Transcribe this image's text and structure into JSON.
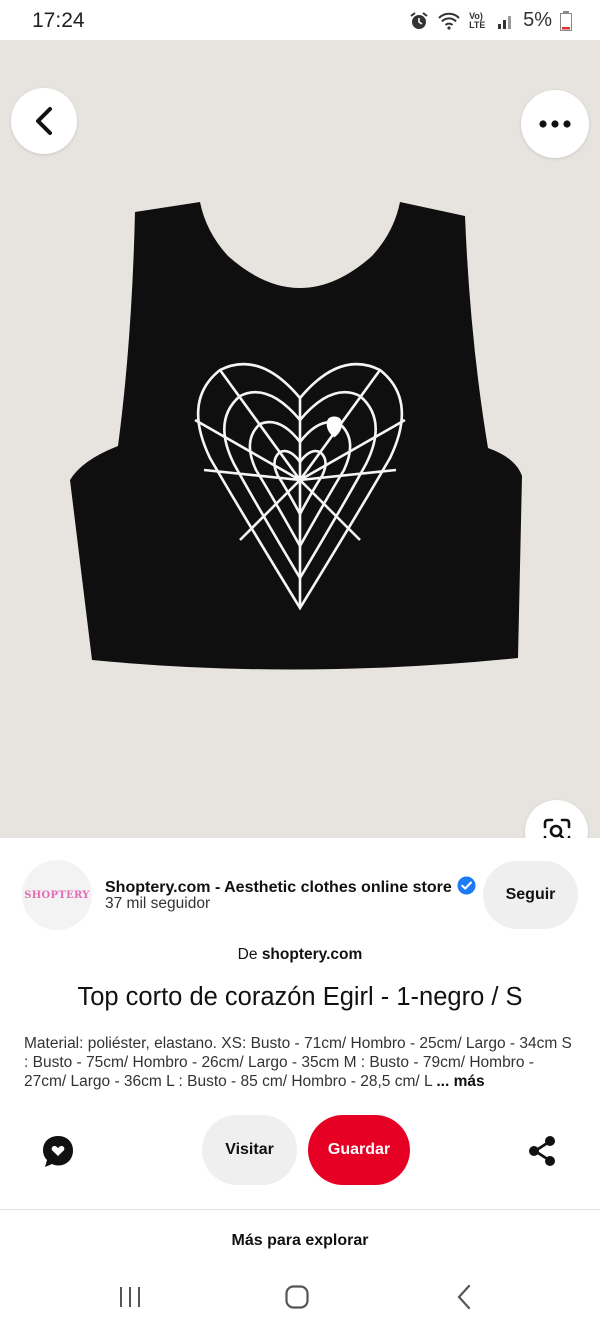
{
  "status_bar": {
    "time": "17:24",
    "network_label": "Vo) LTE",
    "battery": "5%"
  },
  "hero": {
    "icons": {
      "back": "chevron-left-icon",
      "more": "more-horizontal-icon",
      "lens": "visual-search-icon"
    }
  },
  "store": {
    "avatar_text": "SHOPTERY",
    "name": "Shoptery.com - Aesthetic clothes online store",
    "followers": "37 mil seguidor",
    "follow_label": "Seguir",
    "verified_color": "#1d7bf5"
  },
  "source": {
    "prefix": "De",
    "domain": "shoptery.com"
  },
  "pin": {
    "title": "Top corto de corazón Egirl - 1-negro / S",
    "description": "Material: poliéster, elastano. XS: Busto - 71cm/ Hombro - 25cm/ Largo - 34cm S : Busto - 75cm/ Hombro - 26cm/ Largo - 35cm M : Busto - 79cm/ Hombro - 27cm/ Largo - 36cm L : Busto - 85 cm/ Hombro - 28,5 cm/ L",
    "more_label": "... más"
  },
  "actions": {
    "visit_label": "Visitar",
    "save_label": "Guardar",
    "save_color": "#e60023"
  },
  "explore_label": "Más para explorar",
  "nav": {
    "icons": [
      "recent-apps-icon",
      "home-icon",
      "back-icon"
    ]
  }
}
